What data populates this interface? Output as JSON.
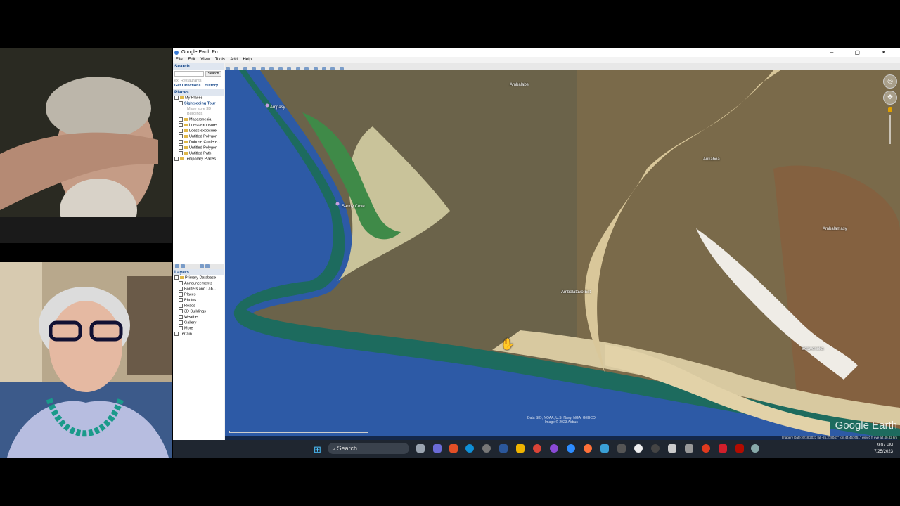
{
  "window": {
    "title": "Google Earth Pro",
    "controls": [
      "–",
      "▢",
      "✕"
    ]
  },
  "menu": [
    "File",
    "Edit",
    "View",
    "Tools",
    "Add",
    "Help"
  ],
  "sidebar": {
    "search_head": "Search",
    "search_button": "Search",
    "search_hint": "ex: Restaurants",
    "get_directions": "Get Directions",
    "history": "History",
    "places_head": "Places",
    "places": [
      {
        "label": "My Places",
        "link": false
      },
      {
        "label": "Sightseeing Tour",
        "link": true
      },
      {
        "label": "Make sure 3D",
        "link": false,
        "dim": true
      },
      {
        "label": "Buildings",
        "link": false,
        "dim": true
      },
      {
        "label": "Macaronesia",
        "link": false
      },
      {
        "label": "Loess exposure",
        "link": false
      },
      {
        "label": "Loess exposure",
        "link": false
      },
      {
        "label": "Untitled Polygon",
        "link": false
      },
      {
        "label": "Dubose Confere...",
        "link": false
      },
      {
        "label": "Untitled Polygon",
        "link": false
      },
      {
        "label": "Untitled Path",
        "link": false
      },
      {
        "label": "Temporary Places",
        "link": false
      }
    ],
    "layers_head": "Layers",
    "layers": [
      "Primary Database",
      "Announcements",
      "Borders and Lab...",
      "Places",
      "Photos",
      "Roads",
      "3D Buildings",
      "Weather",
      "Gallery",
      "More",
      "Terrain"
    ]
  },
  "map": {
    "labels": {
      "ambalabe": "Ambalabe",
      "ankaboa": "Ankaboa",
      "ambalamasy": "Ambalamasy",
      "tsiv_est": "Ambalatavo Est",
      "cove": "Sandy Cove",
      "ampasy": "Ampasy",
      "belavenoka": "Belavenoka"
    },
    "attribution_1": "Data SIO, NOAA, U.S. Navy, NGA, GEBCO",
    "attribution_2": "Image © 2023 Airbus",
    "status": "Imagery Date: 6/18/2023    lat -25.278047°  lon 44.457651°   elev  0 ft   eye alt 40.82 km",
    "logo": "Google Earth"
  },
  "taskbar": {
    "search": "Search",
    "time": "9:07 PM",
    "date": "7/25/2023"
  },
  "colors": {
    "ocean": "#2d5aa6",
    "sand": "#d8c9a0",
    "land": "#6a6248",
    "river": "#d9c79a"
  }
}
